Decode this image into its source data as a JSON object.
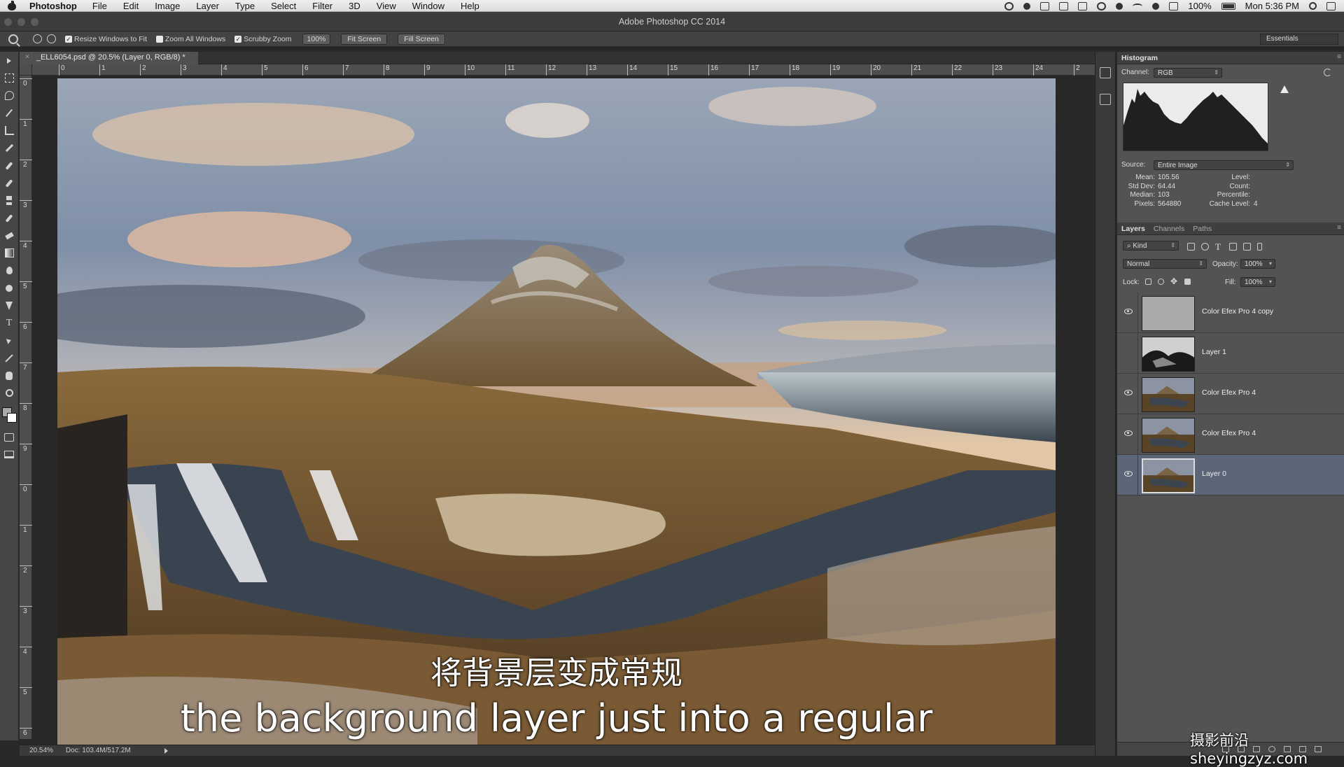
{
  "menubar": {
    "app": "Photoshop",
    "items": [
      "File",
      "Edit",
      "Image",
      "Layer",
      "Type",
      "Select",
      "Filter",
      "3D",
      "View",
      "Window",
      "Help"
    ],
    "battery": "100%",
    "clock": "Mon 5:36 PM"
  },
  "window": {
    "title": "Adobe Photoshop CC 2014"
  },
  "options": {
    "resize_windows": "Resize Windows to Fit",
    "resize_checked": "✓",
    "zoom_all": "Zoom All Windows",
    "scrubby": "Scrubby Zoom",
    "scrubby_checked": "✓",
    "zoom_value": "100%",
    "fit_screen": "Fit Screen",
    "fill_screen": "Fill Screen",
    "workspace": "Essentials"
  },
  "document": {
    "tab_title": "_ELL6054.psd @ 20.5% (Layer 0, RGB/8) *",
    "close": "×"
  },
  "ruler": {
    "h": [
      "0",
      "1",
      "2",
      "3",
      "4",
      "5",
      "6",
      "7",
      "8",
      "9",
      "10",
      "11",
      "12",
      "13",
      "14",
      "15",
      "16",
      "17",
      "18",
      "19",
      "20",
      "21",
      "22",
      "23",
      "24",
      "2"
    ],
    "v": [
      "0",
      "1",
      "2",
      "3",
      "4",
      "5",
      "6",
      "7",
      "8",
      "9",
      "0",
      "1",
      "2",
      "3",
      "4",
      "5",
      "6"
    ]
  },
  "status": {
    "zoom": "20.54%",
    "doc": "Doc: 103.4M/517.2M"
  },
  "subtitles": {
    "cn": "将背景层变成常规",
    "en": "the background layer just into a regular"
  },
  "histogram": {
    "title": "Histogram",
    "channel_label": "Channel:",
    "channel": "RGB",
    "source_label": "Source:",
    "source": "Entire Image",
    "mean_label": "Mean:",
    "mean": "105.56",
    "std_label": "Std Dev:",
    "std": "64.44",
    "median_label": "Median:",
    "median": "103",
    "pixels_label": "Pixels:",
    "pixels": "564880",
    "level_label": "Level:",
    "count_label": "Count:",
    "percentile_label": "Percentile:",
    "cache_label": "Cache Level:",
    "cache": "4"
  },
  "layers_panel": {
    "tabs": [
      "Layers",
      "Channels",
      "Paths"
    ],
    "filter": "Kind",
    "blend_mode": "Normal",
    "opacity_label": "Opacity:",
    "opacity": "100%",
    "lock_label": "Lock:",
    "fill_label": "Fill:",
    "fill": "100%",
    "layers": [
      {
        "name": "Color Efex Pro 4 copy",
        "visible": true
      },
      {
        "name": "Layer 1",
        "visible": false
      },
      {
        "name": "Color Efex Pro 4",
        "visible": true
      },
      {
        "name": "Color Efex Pro 4",
        "visible": true
      },
      {
        "name": "Layer 0",
        "visible": true
      }
    ]
  },
  "watermark": "摄影前沿sheyingzyz.com"
}
